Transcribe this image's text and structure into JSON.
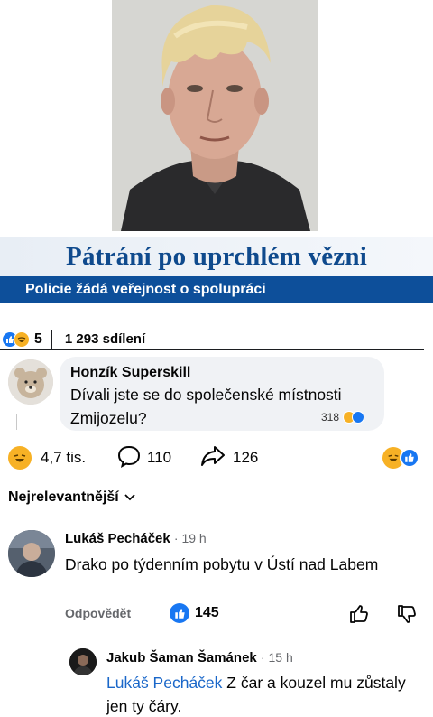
{
  "banner": {
    "title": "Pátrání po uprchlém vězni",
    "subtitle": "Policie žádá veřejnost o spolupráci"
  },
  "share_row": {
    "reaction_count": "5",
    "shares": "1 293 sdílení"
  },
  "quoted_comment": {
    "author": "Honzík Superskill",
    "text": "Dívali jste se do společenské místnosti Zmijozelu?",
    "reaction_count": "318"
  },
  "reaction_bar": {
    "reactions": "4,7 tis.",
    "comments": "110",
    "shares": "126"
  },
  "sort": {
    "label": "Nejrelevantnější"
  },
  "comments": [
    {
      "author": "Lukáš Pecháček",
      "time": "· 19 h",
      "text": "Drako po týdenním pobytu v Ústí nad Labem",
      "reply_label": "Odpovědět",
      "likes": "145"
    },
    {
      "author": "Jakub Šaman Šamánek",
      "time": "· 15 h",
      "mention": "Lukáš Pecháček",
      "text": " Z čar a kouzel mu zůstaly jen ty čáry."
    }
  ],
  "colors": {
    "facebook_blue": "#1877f2",
    "banner_blue": "#0d4f9a",
    "banner_title": "#0f4a8d",
    "haha_yellow": "#f7b125",
    "mention_blue": "#1a67c9"
  }
}
